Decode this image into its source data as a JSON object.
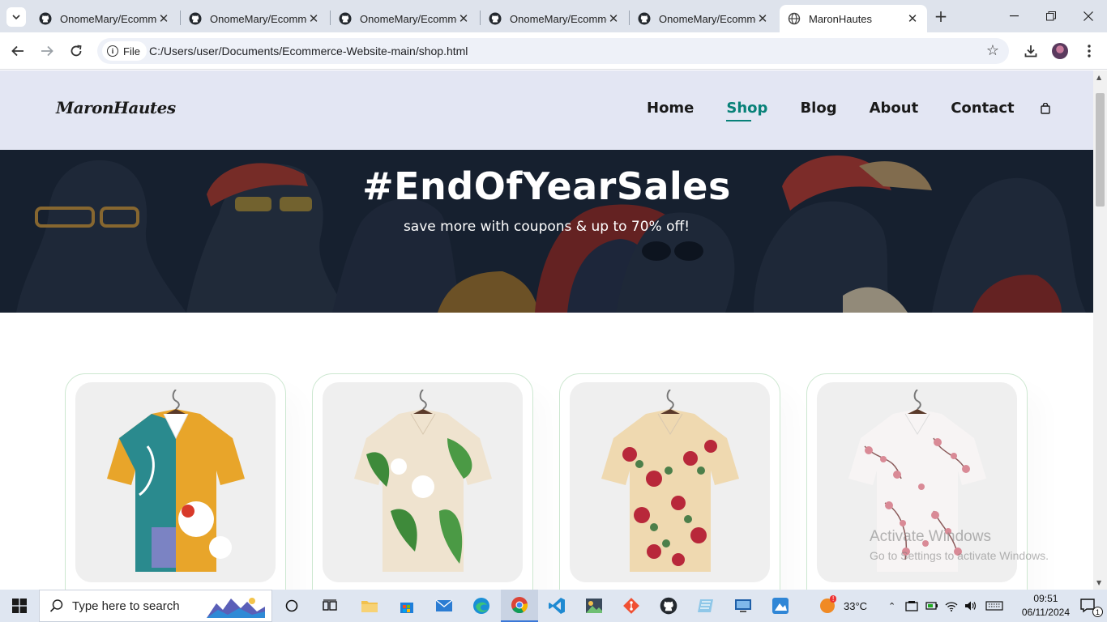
{
  "browser": {
    "tabs": [
      {
        "title": "OnomeMary/Ecommerce",
        "active": false
      },
      {
        "title": "OnomeMary/Ecommerce",
        "active": false
      },
      {
        "title": "OnomeMary/Ecommerce",
        "active": false
      },
      {
        "title": "OnomeMary/Ecommerce",
        "active": false
      },
      {
        "title": "OnomeMary/Ecommerce",
        "active": false
      },
      {
        "title": "MaronHautes",
        "active": true
      }
    ],
    "chip_label": "File",
    "url": "C:/Users/user/Documents/Ecommerce-Website-main/shop.html"
  },
  "site": {
    "logo": "MaronHautes",
    "nav": [
      "Home",
      "Shop",
      "Blog",
      "About",
      "Contact"
    ],
    "active_nav": "Shop",
    "hero_title": "#EndOfYearSales",
    "hero_subtitle": "save more with coupons & up to 70% off!",
    "products": [
      {
        "pattern": "abstract-floral-multicolor"
      },
      {
        "pattern": "tropical-leaf-beige"
      },
      {
        "pattern": "rose-floral-cream"
      },
      {
        "pattern": "cherry-blossom-white"
      }
    ],
    "accent_color": "#088178"
  },
  "watermark": {
    "line1": "Activate Windows",
    "line2": "Go to Settings to activate Windows."
  },
  "taskbar": {
    "search_placeholder": "Type here to search",
    "weather": "33°C",
    "time": "09:51",
    "date": "06/11/2024",
    "notification_count": "1"
  }
}
